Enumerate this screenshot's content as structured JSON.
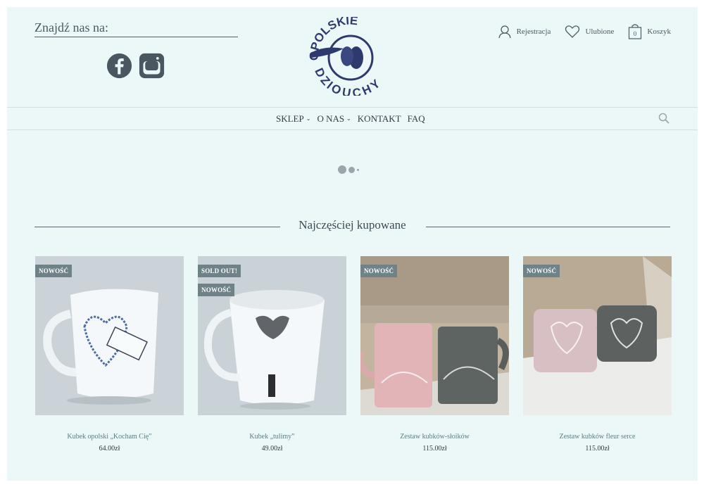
{
  "header": {
    "find_us_label": "Znajdź nas na:",
    "social": [
      {
        "name": "facebook-icon"
      },
      {
        "name": "instagram-icon"
      }
    ],
    "logo_text_top": "OPOLSKIE",
    "logo_text_bottom": "DZIOUCHY",
    "account": {
      "register_label": "Rejestracja",
      "favorites_label": "Ulubione",
      "cart_label": "Koszyk",
      "cart_count": "0"
    }
  },
  "menu": {
    "items": [
      {
        "label": "SKLEP",
        "has_dropdown": true
      },
      {
        "label": "O NAS",
        "has_dropdown": true
      },
      {
        "label": "KONTAKT",
        "has_dropdown": false
      },
      {
        "label": "FAQ",
        "has_dropdown": false
      }
    ],
    "search_icon": "search-icon"
  },
  "section": {
    "title": "Najczęściej kupowane"
  },
  "products": [
    {
      "name": "Kubek opolski „Kocham Cię”",
      "price": "64.00zł",
      "badges": [
        "NOWOŚĆ"
      ]
    },
    {
      "name": "Kubek „tulimy”",
      "price": "49.00zł",
      "badges": [
        "SOLD OUT!",
        "NOWOŚĆ"
      ]
    },
    {
      "name": "Zestaw kubków-słoików",
      "price": "115.00zł",
      "badges": [
        "NOWOŚĆ"
      ]
    },
    {
      "name": "Zestaw kubków fleur serce",
      "price": "115.00zł",
      "badges": [
        "NOWOŚĆ"
      ]
    }
  ],
  "colors": {
    "page_bg": "#ecf8f8",
    "text": "#3d4a54",
    "badge_bg": "#6f8288",
    "logo": "#2e3a6e"
  }
}
